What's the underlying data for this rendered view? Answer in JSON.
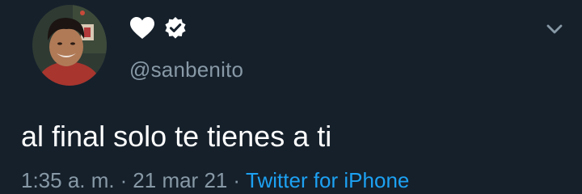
{
  "tweet": {
    "author": {
      "handle": "@sanbenito",
      "avatar_icon": "profile-photo",
      "name_emoji_icon": "white-heart-icon",
      "verified_icon": "verified-badge-icon"
    },
    "text": "al final solo te tienes a ti",
    "meta": {
      "time": "1:35 a. m.",
      "separator": "·",
      "date": "21 mar 21",
      "source": "Twitter for iPhone"
    },
    "menu_icon": "chevron-down-icon"
  },
  "colors": {
    "background": "#15202b",
    "primary_text": "#ffffff",
    "secondary_text": "#8899a6",
    "link": "#1da1f2"
  }
}
